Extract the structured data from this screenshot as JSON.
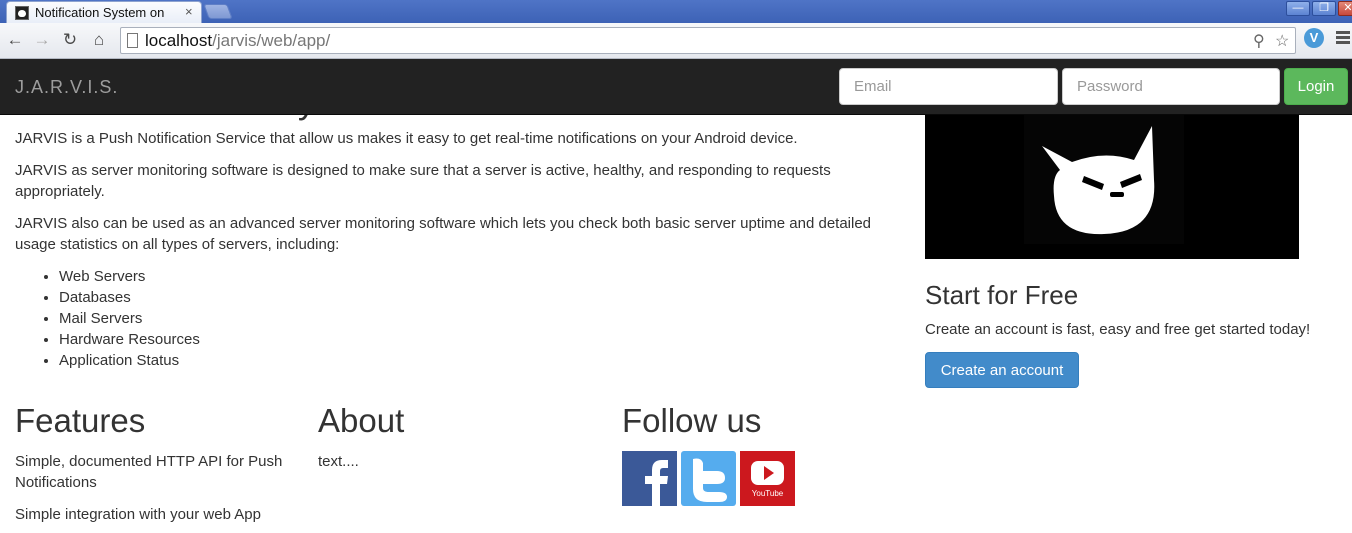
{
  "browser": {
    "tab_title": "Notification System on",
    "tab_close": "×",
    "url_host": "localhost",
    "url_path": "/jarvis/web/app/",
    "window_buttons": [
      "—",
      "❐",
      "✕"
    ]
  },
  "navbar": {
    "brand": "J.A.R.V.I.S.",
    "email_placeholder": "Email",
    "password_placeholder": "Password",
    "login_label": "Login"
  },
  "intro": {
    "heading": "Your notification system",
    "paragraphs": [
      "JARVIS is a Push Notification Service that allow us makes it easy to get real-time notifications on your Android device.",
      "JARVIS as server monitoring software is designed to make sure that a server is active, healthy, and responding to requests appropriately.",
      "JARVIS also can be used as an advanced server monitoring software which lets you check both basic server uptime and detailed usage statistics on all types of servers, including:"
    ],
    "list": [
      "Web Servers",
      "Databases",
      "Mail Servers",
      "Hardware Resources",
      "Application Status"
    ]
  },
  "sidebar": {
    "title": "Start for Free",
    "text": "Create an account is fast, easy and free get started today!",
    "button": "Create an account"
  },
  "features": {
    "title": "Features",
    "items": [
      "Simple, documented HTTP API for Push Notifications",
      "Simple integration with your web App"
    ]
  },
  "about": {
    "title": "About",
    "text": "text...."
  },
  "follow": {
    "title": "Follow us",
    "youtube_label": "YouTube"
  },
  "colors": {
    "navbar": "#222222",
    "login": "#5cb85c",
    "primary": "#428bca",
    "facebook": "#3b5998",
    "twitter": "#55acee",
    "youtube": "#cc181e"
  }
}
